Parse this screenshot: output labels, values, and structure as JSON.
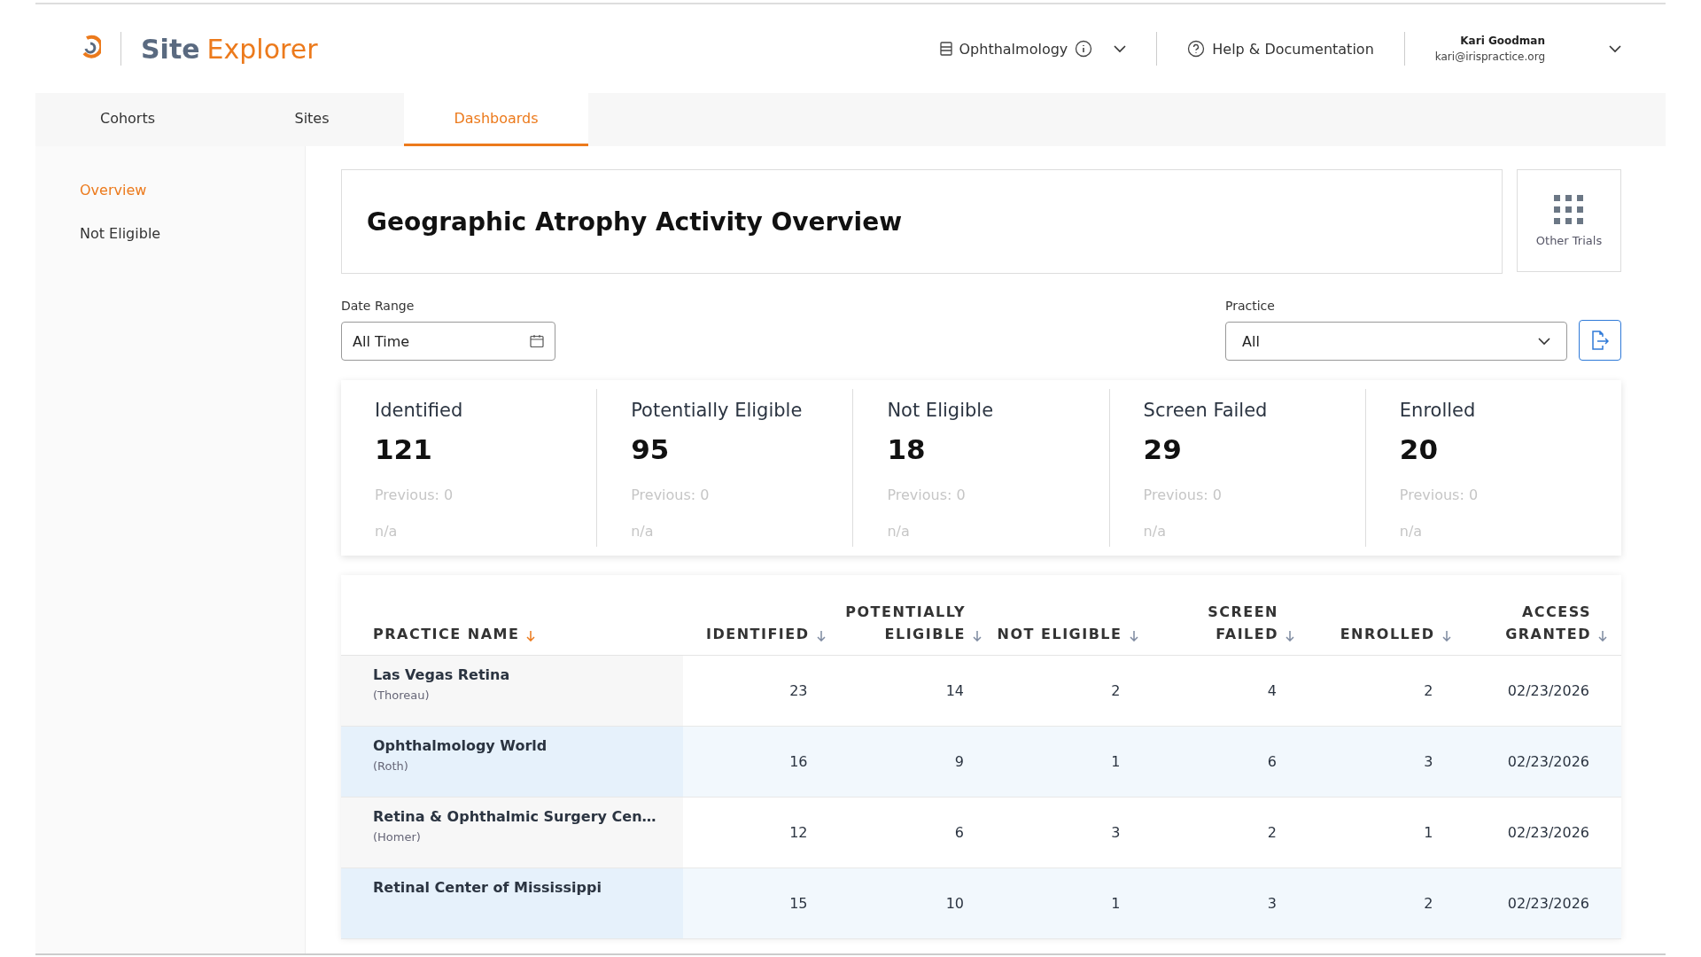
{
  "header": {
    "brand_first": "Site",
    "brand_second": "Explorer",
    "specialty": "Ophthalmology",
    "help": "Help & Documentation",
    "user_name": "Kari Goodman",
    "user_email": "kari@irispractice.org"
  },
  "tabs": [
    {
      "label": "Cohorts",
      "selected": false
    },
    {
      "label": "Sites",
      "selected": false
    },
    {
      "label": "Dashboards",
      "selected": true
    }
  ],
  "sidebar": {
    "items": [
      {
        "label": "Overview",
        "selected": true
      },
      {
        "label": "Not Eligible",
        "selected": false
      }
    ]
  },
  "title": "Geographic Atrophy Activity Overview",
  "other_trials": "Other Trials",
  "date_range": {
    "label": "Date Range",
    "value": "All Time"
  },
  "practice": {
    "label": "Practice",
    "value": "All"
  },
  "stats": [
    {
      "label": "Identified",
      "value": "121",
      "previous": "Previous: 0",
      "change": "n/a"
    },
    {
      "label": "Potentially Eligible",
      "value": "95",
      "previous": "Previous: 0",
      "change": "n/a"
    },
    {
      "label": "Not Eligible",
      "value": "18",
      "previous": "Previous: 0",
      "change": "n/a"
    },
    {
      "label": "Screen Failed",
      "value": "29",
      "previous": "Previous: 0",
      "change": "n/a"
    },
    {
      "label": "Enrolled",
      "value": "20",
      "previous": "Previous: 0",
      "change": "n/a"
    }
  ],
  "table": {
    "columns": [
      {
        "label": "PRACTICE NAME",
        "sorted": true
      },
      {
        "label": "IDENTIFIED",
        "sorted": false
      },
      {
        "label": "POTENTIALLY ELIGIBLE",
        "sorted": false
      },
      {
        "label": "NOT ELIGIBLE",
        "sorted": false
      },
      {
        "label": "SCREEN FAILED",
        "sorted": false
      },
      {
        "label": "ENROLLED",
        "sorted": false
      },
      {
        "label": "ACCESS GRANTED",
        "sorted": false
      }
    ],
    "rows": [
      {
        "cells": [
          "Las Vegas Retina",
          "23",
          "14",
          "2",
          "4",
          "2",
          "02/23/2026"
        ],
        "sub": "(Thoreau)"
      },
      {
        "cells": [
          "Ophthalmology World",
          "16",
          "9",
          "1",
          "6",
          "3",
          "02/23/2026"
        ],
        "sub": "(Roth)"
      },
      {
        "cells": [
          "Retina & Ophthalmic Surgery Cen…",
          "12",
          "6",
          "3",
          "2",
          "1",
          "02/23/2026"
        ],
        "sub": "(Homer)"
      },
      {
        "cells": [
          "Retinal Center of Mississippi",
          "15",
          "10",
          "1",
          "3",
          "2",
          "02/23/2026"
        ]
      }
    ]
  }
}
